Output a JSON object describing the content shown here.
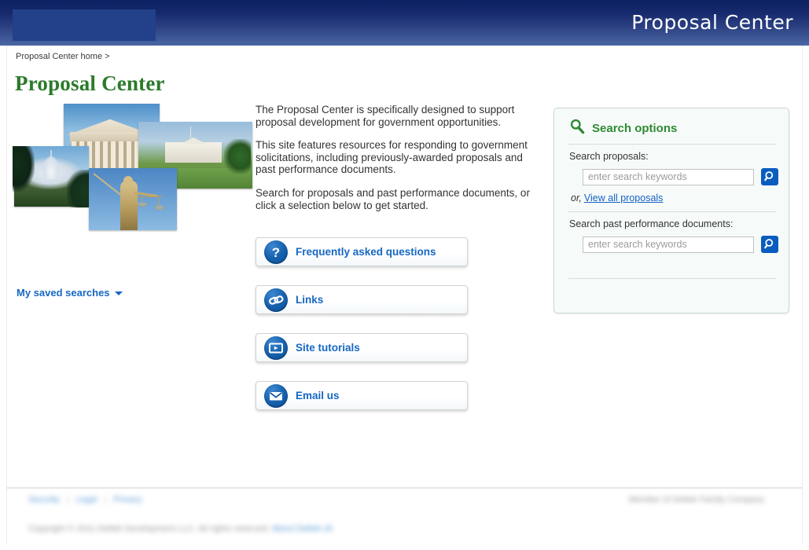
{
  "header": {
    "app_title": "Proposal Center",
    "logo_placeholder": "",
    "gradient_top": "#0a2162",
    "gradient_bottom": "#4a67a4"
  },
  "breadcrumb": {
    "text": "Proposal Center home >"
  },
  "page": {
    "title": "Proposal Center",
    "title_color": "#2b7a2b"
  },
  "collage": {
    "photos": [
      {
        "name": "us-capitol-photo",
        "alt": "United States Capitol building"
      },
      {
        "name": "supreme-court-photo",
        "alt": "United States Supreme Court building"
      },
      {
        "name": "white-house-photo",
        "alt": "The White House with cherry blossoms"
      },
      {
        "name": "lady-justice-photo",
        "alt": "Lady Justice statue with scales and sword"
      }
    ]
  },
  "intro": {
    "paragraphs": [
      "The Proposal Center is specifically designed to support proposal development for government opportunities.",
      "This site features resources for responding to government solicitations, including previously-awarded proposals and past performance documents.",
      "Search for proposals and past performance documents, or click a selection below to get started."
    ]
  },
  "buttons": [
    {
      "label": "Frequently asked questions",
      "icon": "question-mark-icon",
      "name": "faq-button"
    },
    {
      "label": "Links",
      "icon": "chain-link-icon",
      "name": "links-button"
    },
    {
      "label": "Site tutorials",
      "icon": "video-play-icon",
      "name": "site-tutorials-button"
    },
    {
      "label": "Email us",
      "icon": "envelope-icon",
      "name": "email-us-button"
    }
  ],
  "search_panel": {
    "title": "Search options",
    "title_color": "#2f8a34",
    "icon": "magnifier-icon",
    "proposals": {
      "label": "Search proposals:",
      "input_value": "",
      "placeholder": "enter search keywords",
      "go_icon": "magnifier-icon"
    },
    "or_text": "or,",
    "view_all_link": "View all proposals",
    "past_performance": {
      "label": "Search past performance documents:",
      "input_value": "",
      "placeholder": "enter search keywords",
      "go_icon": "magnifier-icon"
    },
    "saved_searches": "My saved searches",
    "saved_searches_caret": "chevron-down-icon"
  },
  "footer": {
    "links": [
      "Security",
      "Legal",
      "Privacy"
    ],
    "separator": "|",
    "right_text": "Member of Deltek Family Company",
    "copyright": "Copyright © 2011 Deltek Development LLC. All rights reserved.",
    "copyright_link": "About Deltek s5"
  }
}
